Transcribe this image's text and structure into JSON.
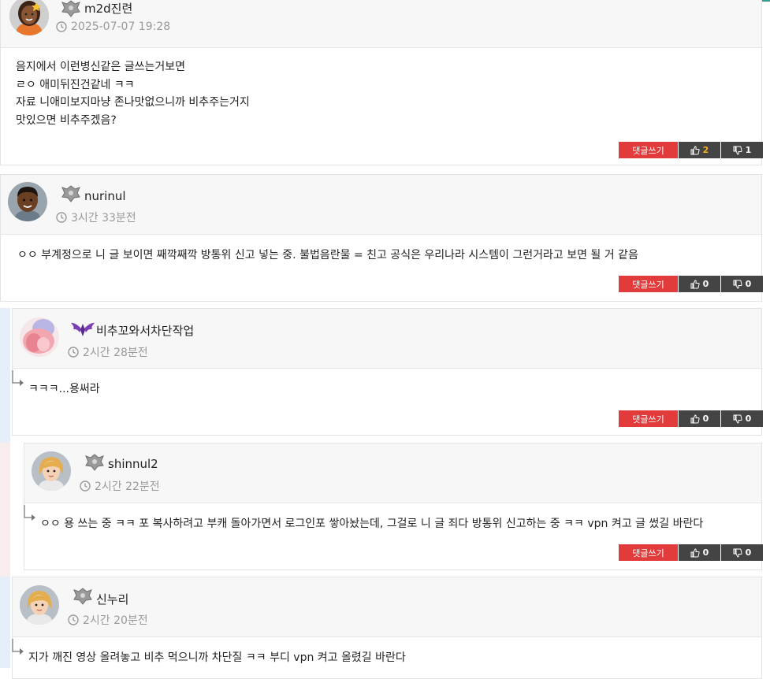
{
  "colors": {
    "accent_red": "#e23b3b",
    "vote_bg": "#444444",
    "upvote_highlight": "#f5b325",
    "header_bg": "#f7f7f7",
    "thread_blue": "#e6eef9",
    "thread_pink": "#f9ecec"
  },
  "labels": {
    "reply_button": "댓글쓰기"
  },
  "comments": [
    {
      "user": "m2d진련",
      "time": "2025-07-07 19:28",
      "avatar": "avatar-woman-dark",
      "level_icon": "gray-dragon-badge-icon",
      "lines": [
        "음지에서 이런병신같은 글쓰는거보면",
        "ㄹㅇ 애미뒤진건같네 ㅋㅋ",
        "자료 니애미보지마냥 존나맛없으니까 비추주는거지",
        "맛있으면 비추주겠음?"
      ],
      "up": "2",
      "down": "1"
    },
    {
      "user": "nurinul",
      "time": "3시간 33분전",
      "avatar": "avatar-man-dark",
      "level_icon": "gray-dragon-badge-icon",
      "lines": [
        "ㅇㅇ 부계정으로 니 글 보이면 째깍째깍 방통위 신고 넣는 중. 불법음란물 = 친고 공식은 우리나라 시스템이 그런거라고 보면 될 거 같음"
      ],
      "up": "0",
      "down": "0"
    },
    {
      "user": "비추꼬와서차단작업",
      "time": "2시간 28분전",
      "avatar": "avatar-anime-pink",
      "level_icon": "purple-wing-badge-icon",
      "lines": [
        "ㅋㅋㅋ...용써라"
      ],
      "up": "0",
      "down": "0"
    },
    {
      "user": "shinnul2",
      "time": "2시간 22분전",
      "avatar": "avatar-woman-blonde",
      "level_icon": "gray-dragon-badge-icon",
      "lines": [
        "ㅇㅇ 용 쓰는 중 ㅋㅋ 포 복사하려고 부캐 돌아가면서 로그인포 쌓아놨는데, 그걸로 니 글 죄다 방통위 신고하는 중 ㅋㅋ vpn 켜고 글 썼길 바란다"
      ],
      "up": "0",
      "down": "0"
    },
    {
      "user": "신누리",
      "time": "2시간 20분전",
      "avatar": "avatar-woman-blonde",
      "level_icon": "gray-dragon-badge-icon",
      "lines": [
        "지가 깨진 영상 올려놓고 비추 먹으니까 차단질 ㅋㅋ 부디 vpn 켜고 올렸길 바란다"
      ]
    }
  ]
}
